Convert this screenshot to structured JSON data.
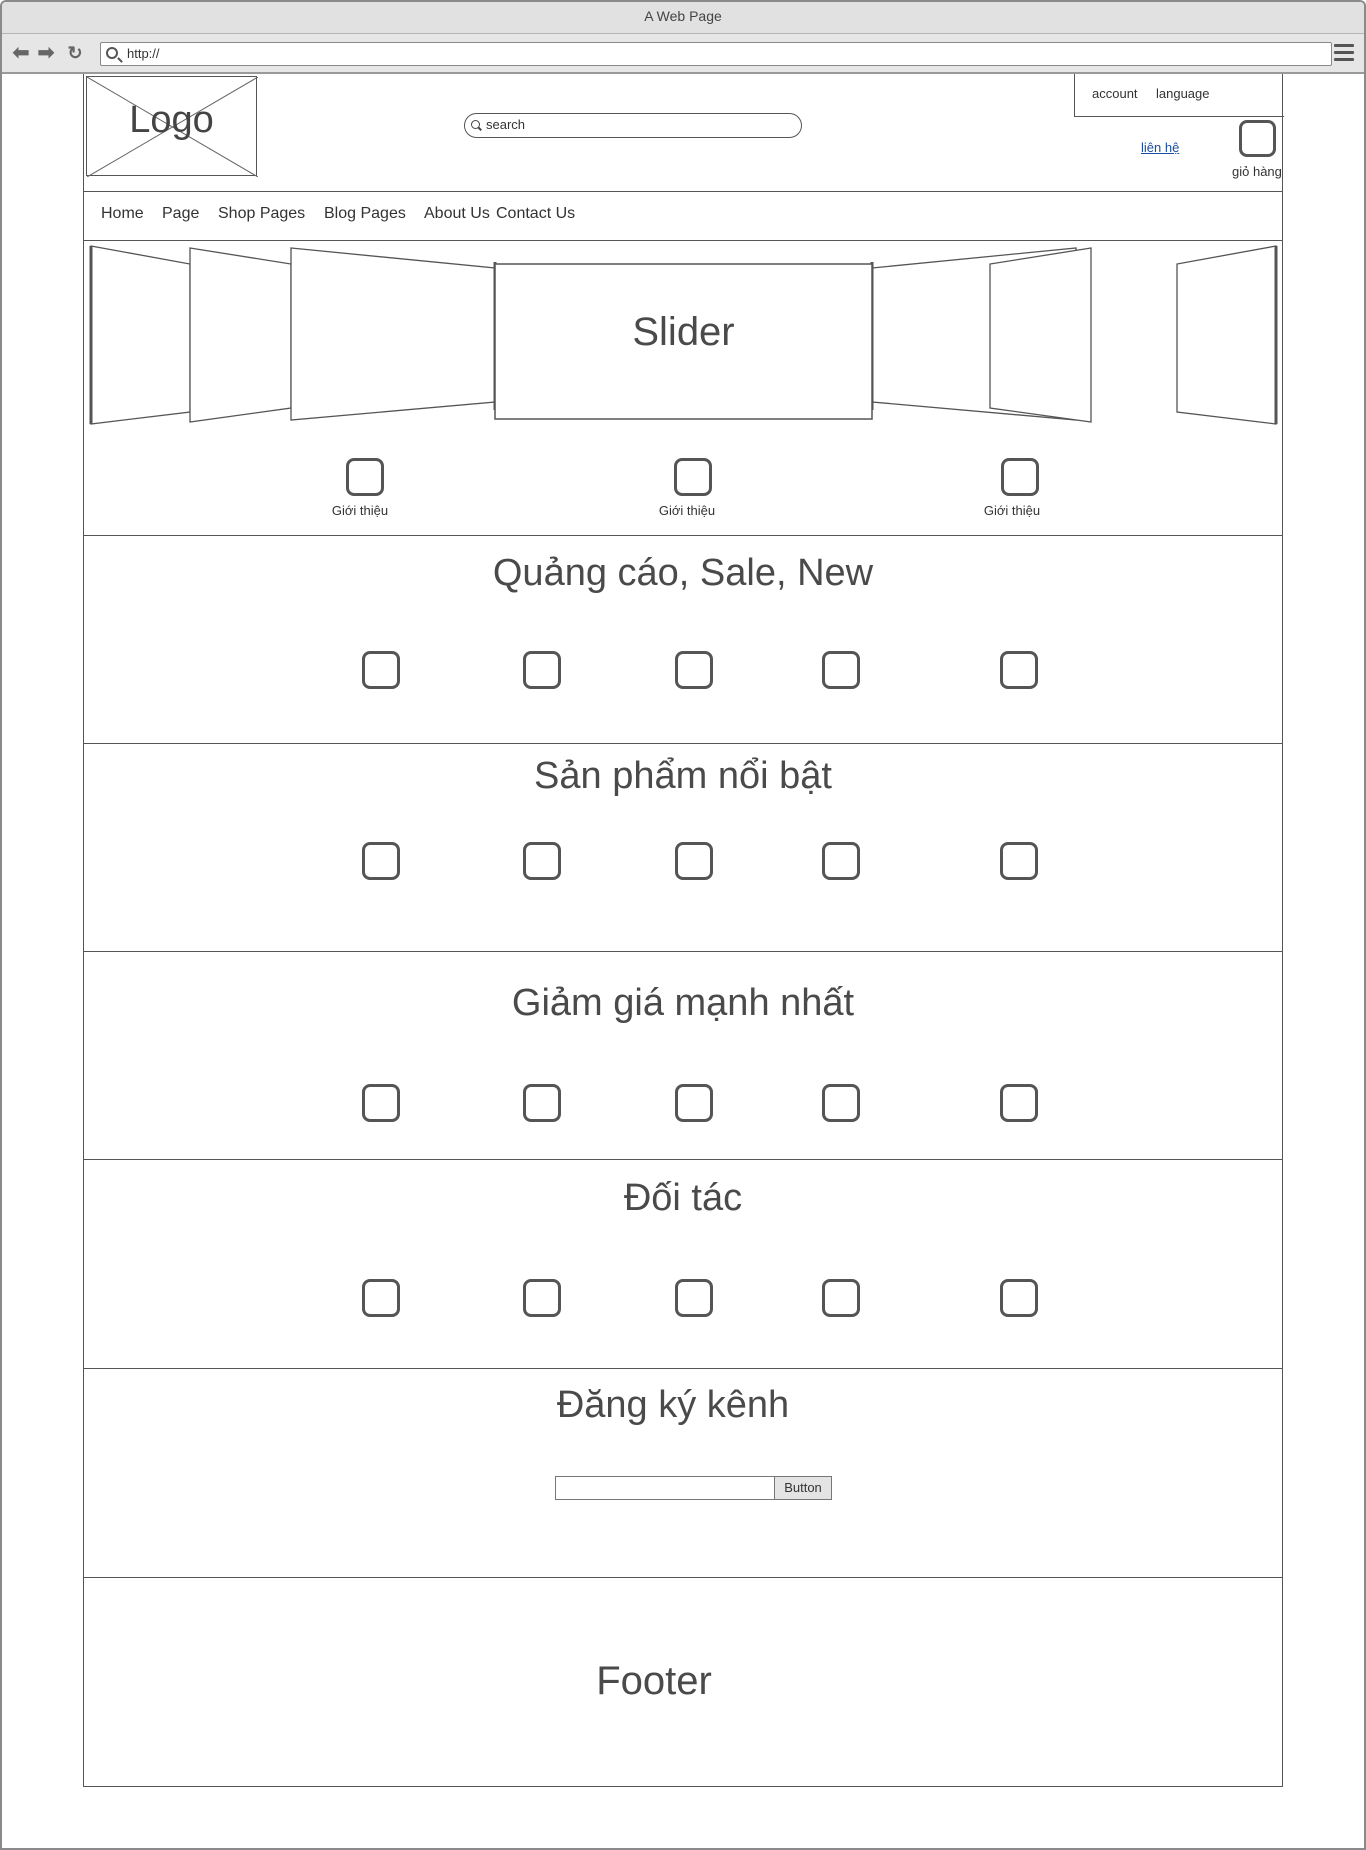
{
  "browser": {
    "title": "A Web Page",
    "url": "http://"
  },
  "header": {
    "logo": "Logo",
    "search_placeholder": "search",
    "account": "account",
    "language": "language",
    "contact_link": "liên hệ",
    "cart_label": "giỏ hàng"
  },
  "nav": {
    "items": [
      "Home",
      "Page",
      "Shop Pages",
      "Blog Pages",
      "About Us",
      "Contact Us"
    ]
  },
  "slider": {
    "label": "Slider",
    "intro_items": [
      "Giới thiệu",
      "Giới thiệu",
      "Giới thiệu"
    ]
  },
  "sections": [
    {
      "title": "Quảng cáo, Sale, New"
    },
    {
      "title": "Sản phẩm nổi bật"
    },
    {
      "title": "Giảm giá mạnh nhất"
    },
    {
      "title": "Đối tác"
    }
  ],
  "subscribe": {
    "title": "Đăng ký kênh",
    "button": "Button"
  },
  "footer": {
    "label": "Footer"
  }
}
